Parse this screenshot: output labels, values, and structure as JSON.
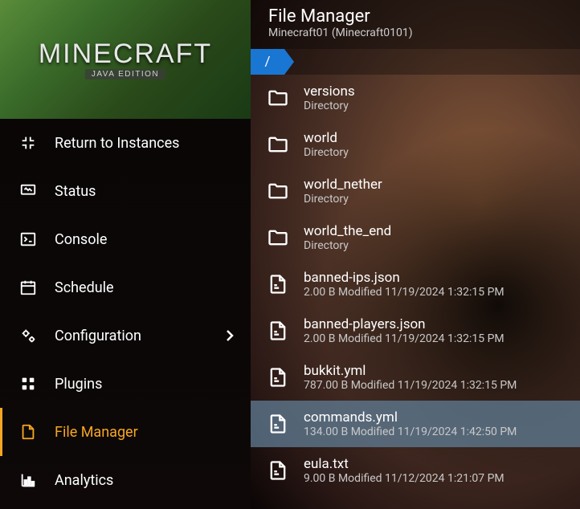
{
  "banner": {
    "title": "MINECRAFT",
    "edition": "JAVA EDITION"
  },
  "nav": {
    "return": "Return to Instances",
    "items": [
      {
        "label": "Status",
        "icon": "status"
      },
      {
        "label": "Console",
        "icon": "console"
      },
      {
        "label": "Schedule",
        "icon": "calendar"
      },
      {
        "label": "Configuration",
        "icon": "gear",
        "chevron": true
      },
      {
        "label": "Plugins",
        "icon": "grid"
      },
      {
        "label": "File Manager",
        "icon": "file",
        "active": true
      },
      {
        "label": "Analytics",
        "icon": "chart"
      }
    ]
  },
  "header": {
    "title": "File Manager",
    "subtitle": "Minecraft01 (Minecraft0101)"
  },
  "breadcrumb": {
    "root": "/"
  },
  "files": [
    {
      "name": "versions",
      "type": "dir",
      "meta": "Directory"
    },
    {
      "name": "world",
      "type": "dir",
      "meta": "Directory"
    },
    {
      "name": "world_nether",
      "type": "dir",
      "meta": "Directory"
    },
    {
      "name": "world_the_end",
      "type": "dir",
      "meta": "Directory"
    },
    {
      "name": "banned-ips.json",
      "type": "file",
      "meta": "2.00 B Modified 11/19/2024 1:32:15 PM"
    },
    {
      "name": "banned-players.json",
      "type": "file",
      "meta": "2.00 B Modified 11/19/2024 1:32:15 PM"
    },
    {
      "name": "bukkit.yml",
      "type": "file",
      "meta": "787.00 B Modified 11/19/2024 1:32:15 PM"
    },
    {
      "name": "commands.yml",
      "type": "file",
      "meta": "134.00 B Modified 11/19/2024 1:42:50 PM",
      "selected": true
    },
    {
      "name": "eula.txt",
      "type": "file",
      "meta": "9.00 B Modified 11/12/2024 1:21:07 PM"
    }
  ]
}
